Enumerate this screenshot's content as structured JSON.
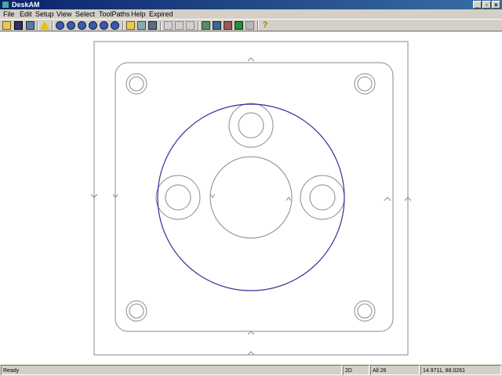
{
  "window": {
    "title": "DeskAM"
  },
  "menu": [
    "File",
    "Edit",
    "Setup",
    "View",
    "Select",
    "ToolPaths",
    "Help",
    "Expired"
  ],
  "status": {
    "message": "Ready",
    "mode": "2D",
    "count": "All 26",
    "coords": "14.9711, 88.0261"
  },
  "colors": {
    "outline": "#8a8a8a",
    "highlight": "#2e2e9a",
    "titlebar": "#0a246a"
  }
}
